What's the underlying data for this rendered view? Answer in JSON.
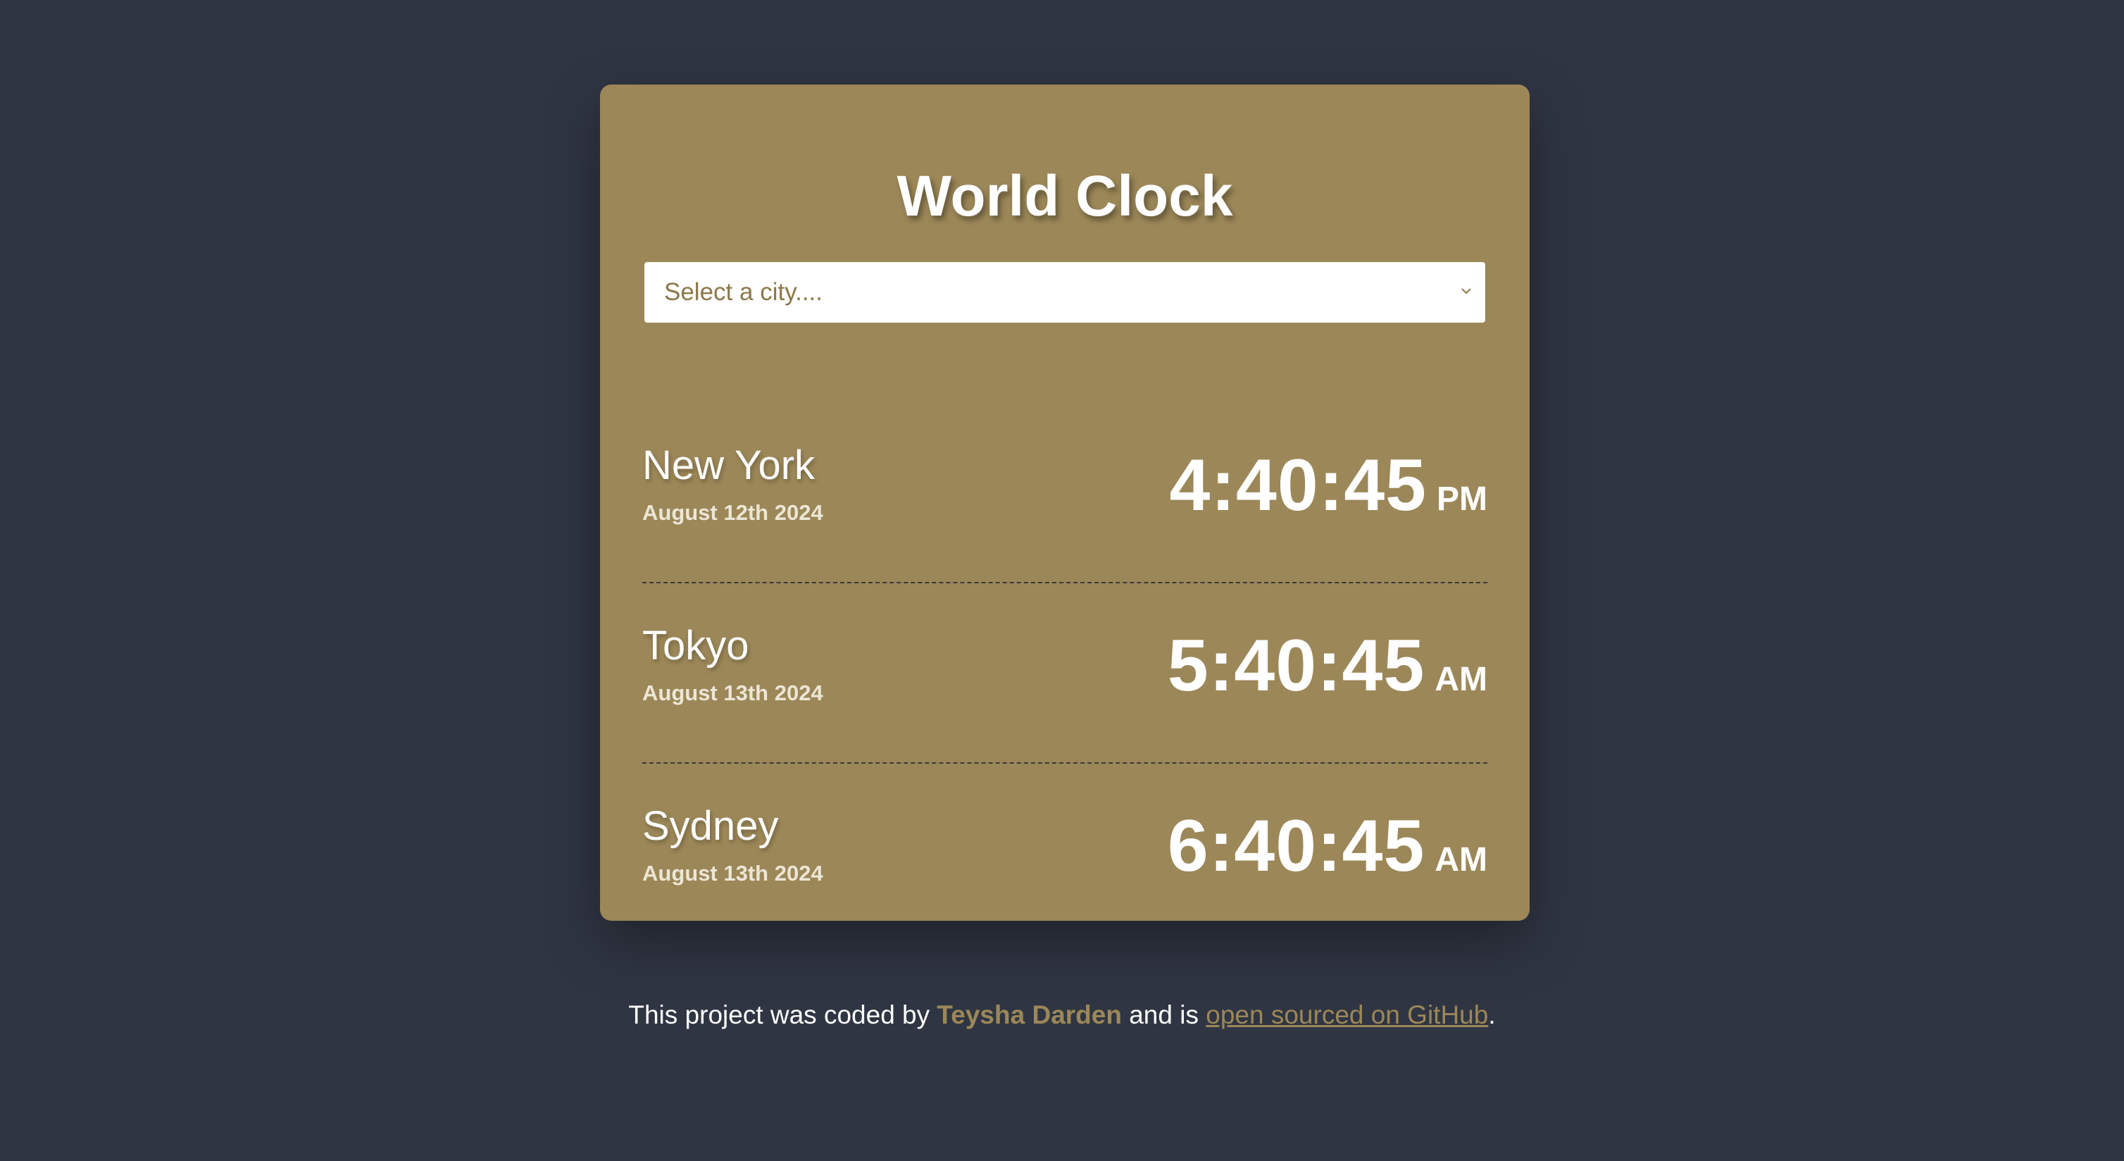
{
  "app": {
    "title": "World Clock"
  },
  "city_select": {
    "placeholder": "Select a city...."
  },
  "cities": [
    {
      "name": "New York",
      "date": "August 12th 2024",
      "time": "4:40:45",
      "ampm": "PM"
    },
    {
      "name": "Tokyo",
      "date": "August 13th 2024",
      "time": "5:40:45",
      "ampm": "AM"
    },
    {
      "name": "Sydney",
      "date": "August 13th 2024",
      "time": "6:40:45",
      "ampm": "AM"
    }
  ],
  "footer": {
    "prefix": "This project was coded by",
    "author": "Teysha Darden",
    "middle": "and is",
    "link_text": "open sourced on GitHub",
    "suffix": "."
  },
  "colors": {
    "background": "#2f3542",
    "card": "#9c8758",
    "text": "#ffffff",
    "accent": "#9c8758"
  },
  "icons": {
    "select_chevron": "chevron-down-icon"
  }
}
